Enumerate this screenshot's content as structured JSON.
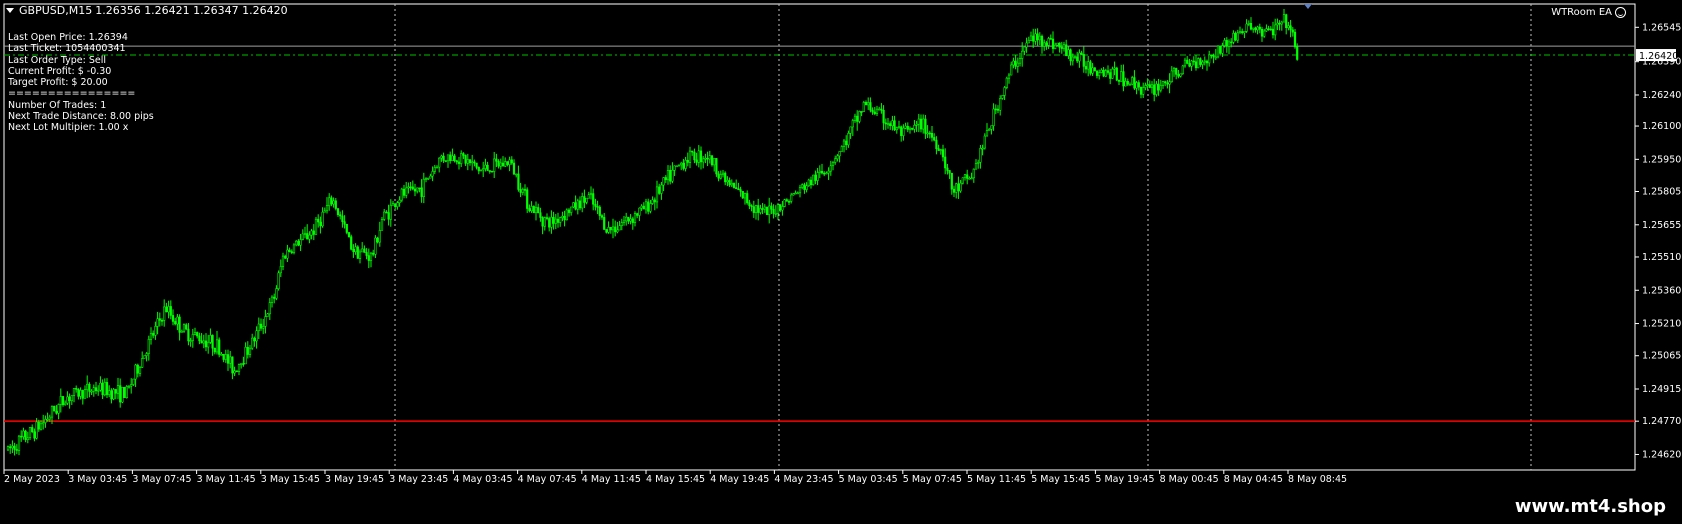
{
  "header": {
    "symbol": "GBPUSD,M15",
    "quote": "1.26356 1.26421 1.26347 1.26420"
  },
  "ea_info": [
    "Last Open Price: 1.26394",
    "Last Ticket: 1054400341",
    "Last Order Type: Sell",
    "Current Profit: $ -0.30",
    "Target Profit: $ 20.00",
    "================",
    "Number Of Trades: 1",
    "Next Trade Distance: 8.00 pips",
    "Next Lot Multipier: 1.00 x"
  ],
  "ea_badge": "WTRoom EA",
  "watermark": "www.mt4.shop",
  "colors": {
    "background": "#000000",
    "candle": "#00ff00",
    "axis": "#ffffff",
    "grid": "#c0c0c0",
    "red_line": "#ff0000",
    "bid_line": "#00c000"
  },
  "chart_data": {
    "type": "candlestick",
    "symbol": "GBPUSD",
    "timeframe": "M15",
    "ylim": [
      1.2455,
      1.2665
    ],
    "y_ticks": [
      "1.26545",
      "1.26390",
      "1.26240",
      "1.26100",
      "1.25950",
      "1.25805",
      "1.25655",
      "1.25510",
      "1.25360",
      "1.25210",
      "1.25065",
      "1.24915",
      "1.24770",
      "1.24620"
    ],
    "x_ticks": [
      "2 May 2023",
      "3 May 03:45",
      "3 May 07:45",
      "3 May 11:45",
      "3 May 15:45",
      "3 May 19:45",
      "3 May 23:45",
      "4 May 03:45",
      "4 May 07:45",
      "4 May 11:45",
      "4 May 15:45",
      "4 May 19:45",
      "4 May 23:45",
      "5 May 03:45",
      "5 May 07:45",
      "5 May 11:45",
      "5 May 15:45",
      "5 May 19:45",
      "8 May 00:45",
      "8 May 04:45",
      "8 May 08:45"
    ],
    "current_price": "1.26420",
    "red_level": 1.2477,
    "bid_level": 1.2642,
    "ask_level": 1.2646,
    "path": [
      [
        0,
        1.2464
      ],
      [
        0.03,
        1.2474
      ],
      [
        0.06,
        1.2488
      ],
      [
        0.09,
        1.2492
      ],
      [
        0.12,
        1.2489
      ],
      [
        0.14,
        1.2509
      ],
      [
        0.16,
        1.2528
      ],
      [
        0.18,
        1.2517
      ],
      [
        0.21,
        1.2512
      ],
      [
        0.23,
        1.25
      ],
      [
        0.25,
        1.2514
      ],
      [
        0.27,
        1.2532
      ],
      [
        0.28,
        1.2552
      ],
      [
        0.31,
        1.2563
      ],
      [
        0.33,
        1.2577
      ],
      [
        0.35,
        1.2555
      ],
      [
        0.37,
        1.2551
      ],
      [
        0.38,
        1.2568
      ],
      [
        0.4,
        1.2579
      ],
      [
        0.42,
        1.2582
      ],
      [
        0.44,
        1.2596
      ],
      [
        0.46,
        1.2596
      ],
      [
        0.48,
        1.259
      ],
      [
        0.51,
        1.2594
      ],
      [
        0.53,
        1.2574
      ],
      [
        0.55,
        1.2566
      ],
      [
        0.57,
        1.2572
      ],
      [
        0.59,
        1.2578
      ],
      [
        0.61,
        1.2563
      ],
      [
        0.63,
        1.2568
      ],
      [
        0.65,
        1.2574
      ],
      [
        0.67,
        1.2586
      ],
      [
        0.69,
        1.2596
      ],
      [
        0.71,
        1.2597
      ],
      [
        0.73,
        1.2585
      ],
      [
        0.75,
        1.2577
      ],
      [
        0.77,
        1.257
      ],
      [
        0.79,
        1.2576
      ],
      [
        0.81,
        1.2583
      ],
      [
        0.83,
        1.259
      ],
      [
        0.85,
        1.2602
      ],
      [
        0.87,
        1.262
      ],
      [
        0.88,
        1.2617
      ],
      [
        0.91,
        1.2606
      ],
      [
        0.93,
        1.2611
      ],
      [
        0.95,
        1.2598
      ],
      [
        0.96,
        1.258
      ],
      [
        0.98,
        1.2588
      ],
      [
        1.0,
        1.2613
      ],
      [
        1.02,
        1.2636
      ],
      [
        1.04,
        1.265
      ],
      [
        1.06,
        1.2648
      ],
      [
        1.08,
        1.2642
      ],
      [
        1.1,
        1.2637
      ],
      [
        1.12,
        1.2634
      ],
      [
        1.14,
        1.263
      ],
      [
        1.16,
        1.2626
      ],
      [
        1.18,
        1.2631
      ],
      [
        1.2,
        1.2638
      ],
      [
        1.22,
        1.2641
      ],
      [
        1.24,
        1.2648
      ],
      [
        1.26,
        1.2655
      ],
      [
        1.28,
        1.2652
      ],
      [
        1.3,
        1.2657
      ],
      [
        1.31,
        1.2642
      ]
    ]
  }
}
